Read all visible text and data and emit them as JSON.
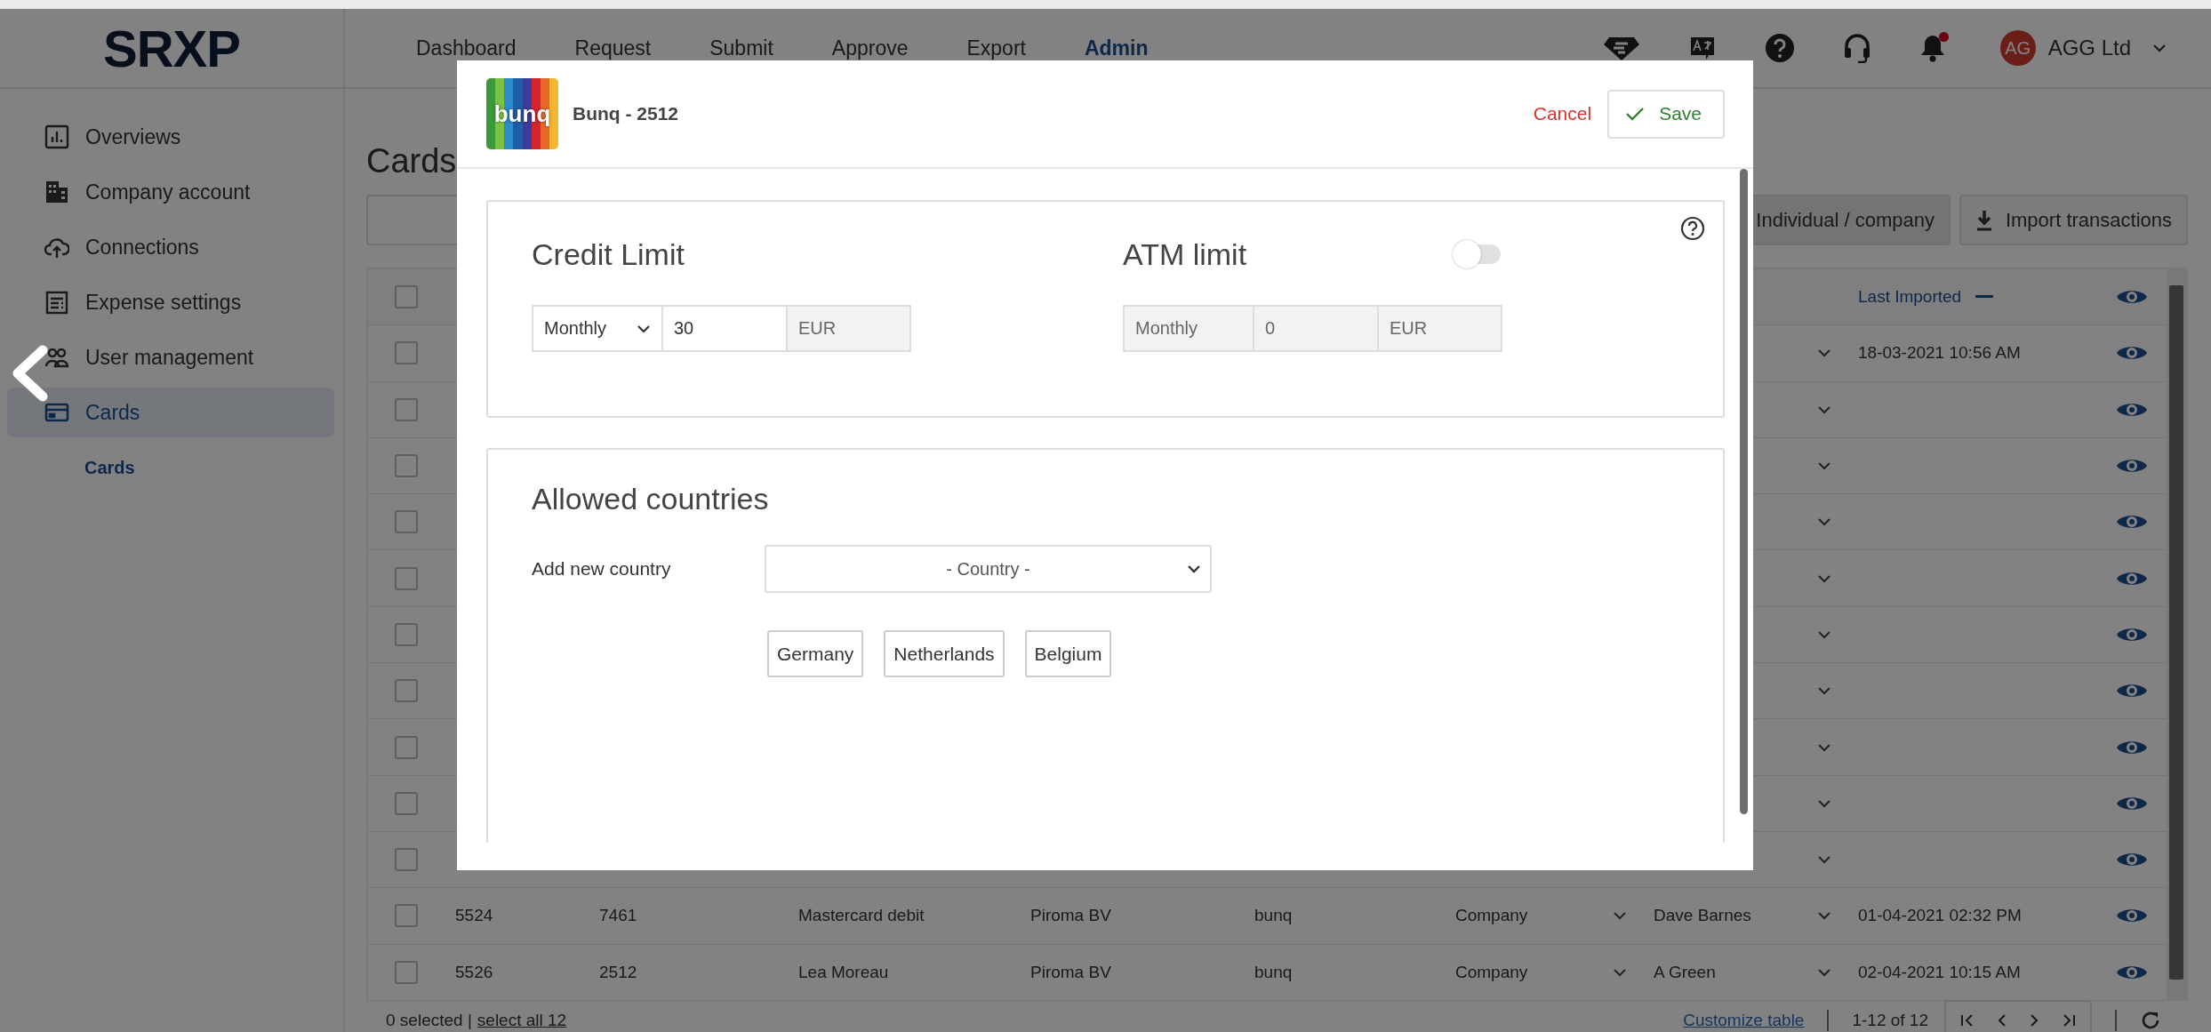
{
  "header": {
    "logo": "SRXP",
    "nav": [
      {
        "label": "Dashboard",
        "selected": false
      },
      {
        "label": "Request",
        "selected": false
      },
      {
        "label": "Submit",
        "selected": false
      },
      {
        "label": "Approve",
        "selected": false
      },
      {
        "label": "Export",
        "selected": false
      },
      {
        "label": "Admin",
        "selected": true
      }
    ],
    "notifications": {
      "unread": true
    },
    "user": {
      "initials": "AG",
      "name": "AGG Ltd"
    }
  },
  "sidebar": {
    "items": [
      {
        "label": "Overviews",
        "selected": false
      },
      {
        "label": "Company account",
        "selected": false
      },
      {
        "label": "Connections",
        "selected": false
      },
      {
        "label": "Expense settings",
        "selected": false
      },
      {
        "label": "User management",
        "selected": false
      },
      {
        "label": "Cards",
        "selected": true,
        "children": [
          {
            "label": "Cards",
            "selected": true
          }
        ]
      }
    ]
  },
  "page": {
    "title": "Cards",
    "buttons": [
      "Individual / company",
      "Import transactions"
    ]
  },
  "table": {
    "select_all_checked": false,
    "last_imported_heading": "Last Imported",
    "rows": [
      {
        "selected": false,
        "last_imported": "18-03-2021 10:56 AM"
      },
      {
        "selected": false
      },
      {
        "selected": false
      },
      {
        "selected": false
      },
      {
        "selected": false
      },
      {
        "selected": false
      },
      {
        "selected": false
      },
      {
        "selected": false
      },
      {
        "selected": false
      },
      {
        "selected": false
      },
      {
        "selected": false,
        "cells": [
          "5524",
          "7461",
          "Mastercard debit",
          "Piroma BV",
          "bunq"
        ],
        "type": "Company",
        "owner": "Dave Barnes",
        "last_imported": "01-04-2021 02:32 PM"
      },
      {
        "selected": false,
        "cells": [
          "5526",
          "2512",
          "Lea Moreau",
          "Piroma BV",
          "bunq"
        ],
        "type": "Company",
        "owner": "A Green",
        "last_imported": "02-04-2021 10:15 AM"
      }
    ]
  },
  "footer": {
    "selected_count": "0 selected |",
    "select_all": "select all 12",
    "customize": "Customize table",
    "range": "1-12 of 12"
  },
  "modal": {
    "logo": "bunq",
    "title": "Bunq - 2512",
    "cancel": "Cancel",
    "save": "Save",
    "credit_limit": {
      "heading": "Credit Limit",
      "period": "Monthly",
      "amount": "30",
      "currency": "EUR"
    },
    "atm_limit": {
      "heading": "ATM limit",
      "on": false,
      "period": "Monthly",
      "amount": "0",
      "currency": "EUR"
    },
    "countries": {
      "heading": "Allowed countries",
      "label": "Add new country",
      "placeholder": "- Country -",
      "items": [
        "Germany",
        "Netherlands",
        "Belgium"
      ]
    }
  }
}
